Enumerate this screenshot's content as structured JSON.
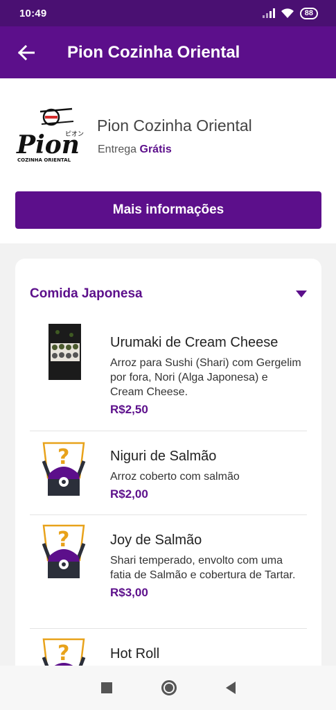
{
  "status": {
    "time": "10:49",
    "battery": "88"
  },
  "header": {
    "title": "Pion Cozinha Oriental"
  },
  "restaurant": {
    "name": "Pion Cozinha Oriental",
    "delivery_label": "Entrega",
    "delivery_value": "Grátis",
    "logo_text": "Pion",
    "logo_sub": "COZINHA ORIENTAL",
    "logo_kana": "ピオン",
    "more_info_label": "Mais informações"
  },
  "menu": {
    "category": "Comida Japonesa",
    "items": [
      {
        "name": "Urumaki de Cream Cheese",
        "description": "Arroz para Sushi (Shari) com Gergelim por fora, Nori (Alga Japonesa) e Cream Cheese.",
        "price": "R$2,50",
        "image": "sushi-photo"
      },
      {
        "name": "Niguri de Salmão",
        "description": "Arroz coberto com salmão",
        "price": "R$2,00",
        "image": "placeholder-mascot-icon"
      },
      {
        "name": "Joy de Salmão",
        "description": "Shari temperado, envolto com uma fatia de Salmão e cobertura de Tartar.",
        "price": "R$3,00",
        "image": "placeholder-mascot-icon"
      },
      {
        "name": "Hot Roll",
        "description": "",
        "price": "",
        "image": "placeholder-mascot-icon"
      }
    ]
  },
  "colors": {
    "primary": "#5c0f8b",
    "status_bar": "#4a1072"
  }
}
